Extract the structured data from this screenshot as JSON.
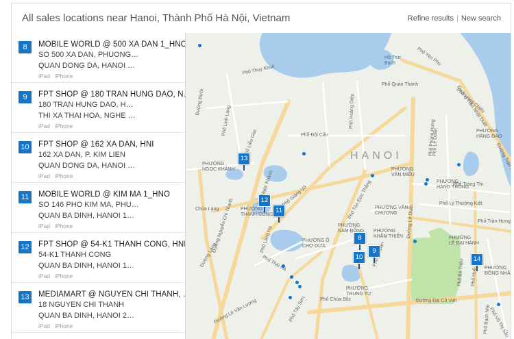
{
  "header": {
    "title": "All sales locations near Hanoi, Thành Phố Hà Nội, Vietnam",
    "refine_label": "Refine results",
    "separator": "|",
    "new_search_label": "New search"
  },
  "results": [
    {
      "num": "8",
      "name": "MOBILE WORLD @ 500 XA DAN 1_HNO",
      "addr1": "SO 500 XA DAN, PHUONG…",
      "addr2": "QUAN DONG DA, HANOI …",
      "devices": [
        "iPad",
        "iPhone"
      ]
    },
    {
      "num": "9",
      "name": "FPT SHOP @ 180 TRAN HUNG DAO, N…",
      "addr1": "180 TRAN HUNG DAO, H…",
      "addr2": "THI XA THAI HOA, NGHE …",
      "devices": [
        "iPad",
        "iPhone"
      ]
    },
    {
      "num": "10",
      "name": "FPT SHOP @ 162 XA DAN, HNI",
      "addr1": "162 XA DAN, P. KIM LIEN",
      "addr2": "QUAN DONG DA, HANOI …",
      "devices": [
        "iPad",
        "iPhone"
      ]
    },
    {
      "num": "11",
      "name": "MOBILE WORLD @ KIM MA 1_HNO",
      "addr1": "SO 146 PHO KIM MA, PHU…",
      "addr2": "QUAN BA DINH, HANOI 1…",
      "devices": [
        "iPad",
        "iPhone"
      ]
    },
    {
      "num": "12",
      "name": "FPT SHOP @ 54-K1 THANH CONG, HNI",
      "addr1": "54-K1 THANH CONG",
      "addr2": "QUAN BA DINH, HANOI 1…",
      "devices": [
        "iPad",
        "iPhone"
      ]
    },
    {
      "num": "13",
      "name": "MEDIAMART @ NGUYEN CHI THANH, …",
      "addr1": "18 NGUYEN CHI THANH",
      "addr2": "QUAN BA DINH, HANOI 2…",
      "devices": [
        "iPad",
        "iPhone"
      ]
    }
  ],
  "map": {
    "city_label": "HANOI",
    "pins": [
      {
        "num": "13"
      },
      {
        "num": "12"
      },
      {
        "num": "11"
      },
      {
        "num": "8"
      },
      {
        "num": "10"
      },
      {
        "num": "9"
      },
      {
        "num": "14"
      }
    ],
    "labels": {
      "ho_truc_bach": "Hồ Trúc\nBạch",
      "pho_quan_thanh": "Phố Quán Thánh",
      "pho_doi_can": "Phố Đội Cấn",
      "phuong_van_mieu": "PHƯỜNG\nVĂN MIẾU",
      "phuong_ngoc_khanh": "PHƯỜNG\nNGỌC KHÁNH",
      "phuong_thanh_cong": "PHƯỜNG\nTHÀNH CÔNG",
      "phuong_o_cho_dua": "PHƯỜNG Ô\nCHỢ DỪA",
      "phuong_nam_dong": "PHƯỜNG\nNAM ĐỒNG",
      "phuong_van_chuong": "PHƯỜNG VĂN\nCHƯƠNG",
      "phuong_kham_thien": "PHƯỜNG\nKHÂM THIÊN",
      "phuong_trung_tu": "PHƯỜNG\nTRUNG TỰ",
      "phuong_le_dai_hanh": "PHƯỜNG\nLÊ ĐẠI HÀNH",
      "phuong_hang_do": "PHƯỜNG\nHÀNG ĐÀO",
      "phuong_hang_trong": "PHƯỜNG\nHÀNG TRỐNG",
      "phuong_dong_nhan": "PHƯỜNG\nĐỒNG NHÂN",
      "pho_trang_thi": "Phố Tràng Thi",
      "pho_ly_thuong_kiet": "Phố Lý Thường Kiệt",
      "pho_tran_hung_dao": "Phố Trần Hưng Đạo",
      "duong_dai_co_viet": "Đường Đại Cồ Việt",
      "pho_chua_boc": "Phố Chùa Bộc",
      "duong_lang": "Đường Láng",
      "pho_giang_vo": "Phố Giảng Võ",
      "pho_ton_duc_thang": "Phố Tôn Đức Thắng",
      "duong_le_duan": "Đường Lê Duẩn",
      "pho_hue": "Phố Huế",
      "pho_ba_trieu": "Phố Bà Triệu",
      "pho_bach_mai": "Phố Bạch Mai",
      "duong_buoi": "Đường Bưởi",
      "pho_linh_lang": "Phố Linh Lang",
      "pho_lieu_giai": "Phố Liễu Giai",
      "pho_ngoc_khanh": "Phố Ngọc Khánh",
      "duong_nguyen_chi_thanh": "Đường Nguyễn Chí Thanh",
      "pho_lang_ha": "Phố Láng Hạ",
      "pho_thai_ha": "Phố Thái Hà",
      "pho_tay_son": "Phố Tây Sơn",
      "pho_xa_dan": "Phố Xã Đàn",
      "duong_le_van_luong": "Đường Lê Văn Lương",
      "pho_hoang_dieu": "Phố Hoàng Diệu",
      "pho_phung_hung": "Phố Phùng Hưng",
      "pho_yen_phu": "Phố Yên Phụ",
      "pho_thuy_khue": "Phố Thụy Khuê",
      "duong_tran_nhat_duat": "Đường Trần Nhật Duật",
      "pho_hang_chieu": "Phố Hàng Chiếu",
      "duong_tran_khanh_du": "Đường Trần Khánh Dư",
      "pho_le_duan": "Phố Lê Duẩn",
      "pho_vo_thi_sau": "Phố Võ Thị Sáu",
      "chua_lang": "Chùa Láng"
    }
  },
  "colors": {
    "accent": "#1775c7",
    "water": "#a9cbec",
    "park": "#bfe3a9",
    "road_major": "#f6d99a",
    "road_minor": "#ffffff",
    "land": "#eef0ea"
  },
  "icons": [
    "map-pin-icon",
    "map-dot-icon"
  ]
}
